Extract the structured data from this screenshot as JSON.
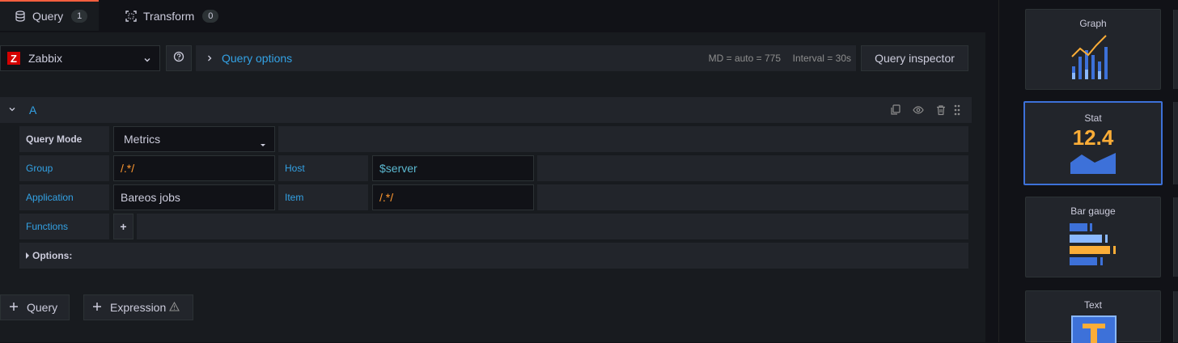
{
  "tabs": [
    {
      "label": "Query",
      "count": "1"
    },
    {
      "label": "Transform",
      "count": "0"
    }
  ],
  "datasource": {
    "name": "Zabbix"
  },
  "query_options": {
    "label": "Query options",
    "md": "MD = auto = 775",
    "interval": "Interval = 30s",
    "inspector_label": "Query inspector"
  },
  "query": {
    "ref_id": "A",
    "query_mode_label": "Query Mode",
    "query_mode_value": "Metrics",
    "group_label": "Group",
    "group_value": "/.*/",
    "host_label": "Host",
    "host_value": "$server",
    "application_label": "Application",
    "application_value": "Bareos jobs",
    "item_label": "Item",
    "item_value": "/.*/",
    "functions_label": "Functions",
    "functions_add": "+",
    "options_label": "Options:"
  },
  "bottom": {
    "query_label": "Query",
    "expression_label": "Expression"
  },
  "viz": [
    {
      "title": "Graph"
    },
    {
      "title": "Stat",
      "value": "12.4"
    },
    {
      "title": "Bar gauge"
    },
    {
      "title": "Text"
    }
  ],
  "colors": {
    "accent_blue": "#33a2e5",
    "selected_border": "#3d71d9",
    "stat_orange": "#fbad37",
    "zabbix_red": "#d40000"
  }
}
